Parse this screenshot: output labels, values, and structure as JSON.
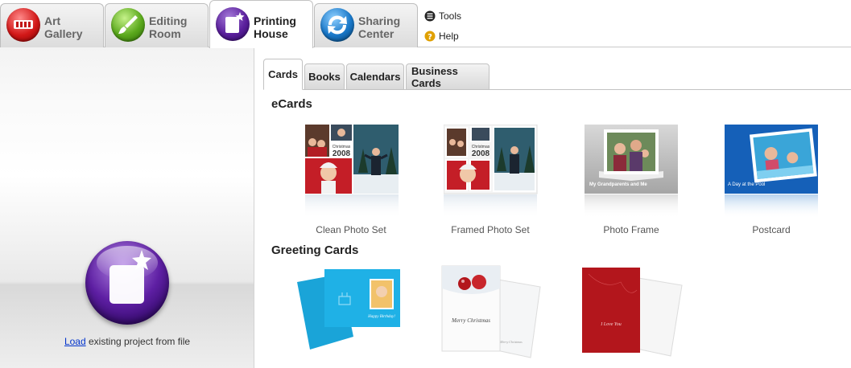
{
  "top_nav": {
    "tabs": [
      {
        "line1": "Art",
        "line2": "Gallery",
        "icon": "art-gallery-icon",
        "color": "#d21818",
        "active": false
      },
      {
        "line1": "Editing",
        "line2": "Room",
        "icon": "paintbrush-icon",
        "color": "#5aa81c",
        "active": false
      },
      {
        "line1": "Printing",
        "line2": "House",
        "icon": "printing-house-icon",
        "color": "#5a1f9c",
        "active": true
      },
      {
        "line1": "Sharing",
        "line2": "Center",
        "icon": "sharing-arrows-icon",
        "color": "#1877c8",
        "active": false
      }
    ],
    "tools_label": "Tools",
    "help_label": "Help"
  },
  "sidebar": {
    "load_link": "Load",
    "load_rest": " existing project from file"
  },
  "subtabs": [
    "Cards",
    "Books",
    "Calendars",
    "Business Cards"
  ],
  "active_subtab": "Cards",
  "sections": [
    {
      "title": "eCards",
      "items": [
        "Clean Photo Set",
        "Framed Photo Set",
        "Photo Frame",
        "Postcard"
      ]
    },
    {
      "title": "Greeting Cards",
      "items": []
    }
  ],
  "thumb_text": {
    "christmas": "Christmas",
    "year": "2008",
    "grandparents": "My Grandparents and Me",
    "pool": "A Day at the Pool",
    "birthday": "Happy Birthday!",
    "merry": "Merry Christmas",
    "love": "I Love You"
  },
  "colors": {
    "accent_purple": "#5a1f9c",
    "link_blue": "#0033cc",
    "postcard_blue": "#1560b8",
    "greeting_cyan": "#1fb1e6",
    "greeting_red": "#b3161c"
  }
}
